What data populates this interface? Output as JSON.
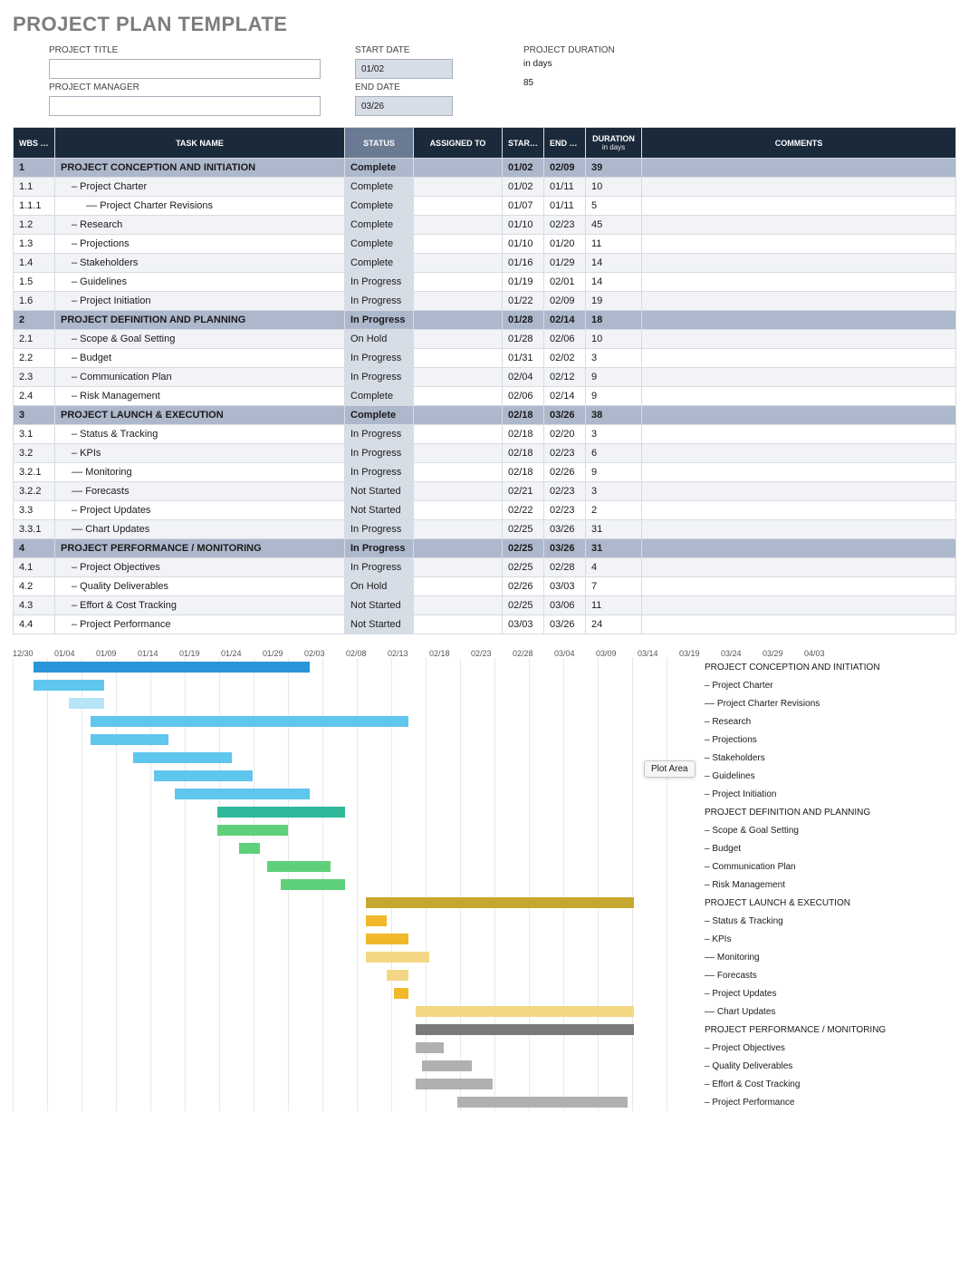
{
  "title": "PROJECT PLAN TEMPLATE",
  "meta": {
    "project_title_label": "PROJECT TITLE",
    "project_manager_label": "PROJECT MANAGER",
    "start_date_label": "START DATE",
    "start_date": "01/02",
    "end_date_label": "END DATE",
    "end_date": "03/26",
    "duration_label": "PROJECT DURATION",
    "duration_unit": "in days",
    "duration_value": "85"
  },
  "columns": {
    "wbs": "WBS NO.",
    "task": "TASK NAME",
    "status": "STATUS",
    "assigned": "ASSIGNED TO",
    "start": "START DATE",
    "end": "END DATE",
    "duration": "DURATION",
    "duration_sub": "in days",
    "comments": "COMMENTS"
  },
  "rows": [
    {
      "wbs": "1",
      "task": "PROJECT CONCEPTION AND INITIATION",
      "indent": 0,
      "section": true,
      "status": "Complete",
      "start": "01/02",
      "end": "02/09",
      "dur": "39"
    },
    {
      "wbs": "1.1",
      "task": "– Project Charter",
      "indent": 1,
      "status": "Complete",
      "start": "01/02",
      "end": "01/11",
      "dur": "10"
    },
    {
      "wbs": "1.1.1",
      "task": "–– Project Charter Revisions",
      "indent": 2,
      "status": "Complete",
      "start": "01/07",
      "end": "01/11",
      "dur": "5"
    },
    {
      "wbs": "1.2",
      "task": "– Research",
      "indent": 1,
      "status": "Complete",
      "start": "01/10",
      "end": "02/23",
      "dur": "45"
    },
    {
      "wbs": "1.3",
      "task": "– Projections",
      "indent": 1,
      "status": "Complete",
      "start": "01/10",
      "end": "01/20",
      "dur": "11"
    },
    {
      "wbs": "1.4",
      "task": "– Stakeholders",
      "indent": 1,
      "status": "Complete",
      "start": "01/16",
      "end": "01/29",
      "dur": "14"
    },
    {
      "wbs": "1.5",
      "task": "– Guidelines",
      "indent": 1,
      "status": "In Progress",
      "start": "01/19",
      "end": "02/01",
      "dur": "14"
    },
    {
      "wbs": "1.6",
      "task": "– Project Initiation",
      "indent": 1,
      "status": "In Progress",
      "start": "01/22",
      "end": "02/09",
      "dur": "19"
    },
    {
      "wbs": "2",
      "task": "PROJECT DEFINITION AND PLANNING",
      "indent": 0,
      "section": true,
      "status": "In Progress",
      "start": "01/28",
      "end": "02/14",
      "dur": "18"
    },
    {
      "wbs": "2.1",
      "task": "– Scope & Goal Setting",
      "indent": 1,
      "status": "On Hold",
      "start": "01/28",
      "end": "02/06",
      "dur": "10"
    },
    {
      "wbs": "2.2",
      "task": "– Budget",
      "indent": 1,
      "status": "In Progress",
      "start": "01/31",
      "end": "02/02",
      "dur": "3"
    },
    {
      "wbs": "2.3",
      "task": "– Communication Plan",
      "indent": 1,
      "status": "In Progress",
      "start": "02/04",
      "end": "02/12",
      "dur": "9"
    },
    {
      "wbs": "2.4",
      "task": "– Risk Management",
      "indent": 1,
      "status": "Complete",
      "start": "02/06",
      "end": "02/14",
      "dur": "9"
    },
    {
      "wbs": "3",
      "task": "PROJECT LAUNCH & EXECUTION",
      "indent": 0,
      "section": true,
      "status": "Complete",
      "start": "02/18",
      "end": "03/26",
      "dur": "38"
    },
    {
      "wbs": "3.1",
      "task": "– Status & Tracking",
      "indent": 1,
      "status": "In Progress",
      "start": "02/18",
      "end": "02/20",
      "dur": "3"
    },
    {
      "wbs": "3.2",
      "task": "– KPIs",
      "indent": 1,
      "status": "In Progress",
      "start": "02/18",
      "end": "02/23",
      "dur": "6"
    },
    {
      "wbs": "3.2.1",
      "task": "–– Monitoring",
      "indent": 1,
      "status": "In Progress",
      "start": "02/18",
      "end": "02/26",
      "dur": "9"
    },
    {
      "wbs": "3.2.2",
      "task": "–– Forecasts",
      "indent": 1,
      "status": "Not Started",
      "start": "02/21",
      "end": "02/23",
      "dur": "3"
    },
    {
      "wbs": "3.3",
      "task": "– Project Updates",
      "indent": 1,
      "status": "Not Started",
      "start": "02/22",
      "end": "02/23",
      "dur": "2"
    },
    {
      "wbs": "3.3.1",
      "task": "–– Chart Updates",
      "indent": 1,
      "status": "In Progress",
      "start": "02/25",
      "end": "03/26",
      "dur": "31"
    },
    {
      "wbs": "4",
      "task": "PROJECT PERFORMANCE / MONITORING",
      "indent": 0,
      "section": true,
      "status": "In Progress",
      "start": "02/25",
      "end": "03/26",
      "dur": "31"
    },
    {
      "wbs": "4.1",
      "task": "– Project Objectives",
      "indent": 1,
      "status": "In Progress",
      "start": "02/25",
      "end": "02/28",
      "dur": "4"
    },
    {
      "wbs": "4.2",
      "task": "– Quality Deliverables",
      "indent": 1,
      "status": "On Hold",
      "start": "02/26",
      "end": "03/03",
      "dur": "7"
    },
    {
      "wbs": "4.3",
      "task": "– Effort & Cost Tracking",
      "indent": 1,
      "status": "Not Started",
      "start": "02/25",
      "end": "03/06",
      "dur": "11"
    },
    {
      "wbs": "4.4",
      "task": "– Project Performance",
      "indent": 1,
      "status": "Not Started",
      "start": "03/03",
      "end": "03/26",
      "dur": "24"
    }
  ],
  "axis": [
    "12/30",
    "01/04",
    "01/09",
    "01/14",
    "01/19",
    "01/24",
    "01/29",
    "02/03",
    "02/08",
    "02/13",
    "02/18",
    "02/23",
    "02/28",
    "03/04",
    "03/09",
    "03/14",
    "03/19",
    "03/24",
    "03/29",
    "04/03"
  ],
  "plot_area_label": "Plot Area",
  "chart_data": {
    "type": "bar",
    "orientation": "horizontal",
    "title": "",
    "xlabel": "",
    "ylabel": "",
    "x_origin": "12/30",
    "x_unit": "days",
    "x_tick_spacing_days": 5,
    "pixels_per_day": 7.8,
    "series": [
      {
        "name": "PROJECT CONCEPTION AND INITIATION",
        "start_offset": 3,
        "duration": 39,
        "color": "#2996d9",
        "group": 1
      },
      {
        "name": "– Project Charter",
        "start_offset": 3,
        "duration": 10,
        "color": "#5fc6ee",
        "group": 1
      },
      {
        "name": "–– Project Charter Revisions",
        "start_offset": 8,
        "duration": 5,
        "color": "#b7e4f7",
        "group": 1
      },
      {
        "name": "– Research",
        "start_offset": 11,
        "duration": 45,
        "color": "#5fc6ee",
        "group": 1
      },
      {
        "name": "– Projections",
        "start_offset": 11,
        "duration": 11,
        "color": "#5fc6ee",
        "group": 1
      },
      {
        "name": "– Stakeholders",
        "start_offset": 17,
        "duration": 14,
        "color": "#5fc6ee",
        "group": 1
      },
      {
        "name": "– Guidelines",
        "start_offset": 20,
        "duration": 14,
        "color": "#5fc6ee",
        "group": 1
      },
      {
        "name": "– Project Initiation",
        "start_offset": 23,
        "duration": 19,
        "color": "#5fc6ee",
        "group": 1
      },
      {
        "name": "PROJECT DEFINITION AND PLANNING",
        "start_offset": 29,
        "duration": 18,
        "color": "#2fb89a",
        "group": 2
      },
      {
        "name": "– Scope & Goal Setting",
        "start_offset": 29,
        "duration": 10,
        "color": "#5fd07a",
        "group": 2
      },
      {
        "name": "– Budget",
        "start_offset": 32,
        "duration": 3,
        "color": "#5fd07a",
        "group": 2
      },
      {
        "name": "– Communication Plan",
        "start_offset": 36,
        "duration": 9,
        "color": "#5fd07a",
        "group": 2
      },
      {
        "name": "– Risk Management",
        "start_offset": 38,
        "duration": 9,
        "color": "#5fd07a",
        "group": 2
      },
      {
        "name": "PROJECT LAUNCH & EXECUTION",
        "start_offset": 50,
        "duration": 38,
        "color": "#c7a82f",
        "group": 3
      },
      {
        "name": "– Status & Tracking",
        "start_offset": 50,
        "duration": 3,
        "color": "#f0b92b",
        "group": 3
      },
      {
        "name": "– KPIs",
        "start_offset": 50,
        "duration": 6,
        "color": "#f0b92b",
        "group": 3
      },
      {
        "name": "–– Monitoring",
        "start_offset": 50,
        "duration": 9,
        "color": "#f4d784",
        "group": 3
      },
      {
        "name": "–– Forecasts",
        "start_offset": 53,
        "duration": 3,
        "color": "#f4d784",
        "group": 3
      },
      {
        "name": "– Project Updates",
        "start_offset": 54,
        "duration": 2,
        "color": "#f0b92b",
        "group": 3
      },
      {
        "name": "–– Chart Updates",
        "start_offset": 57,
        "duration": 31,
        "color": "#f4d784",
        "group": 3
      },
      {
        "name": "PROJECT PERFORMANCE / MONITORING",
        "start_offset": 57,
        "duration": 31,
        "color": "#7a7a7a",
        "group": 4
      },
      {
        "name": "– Project Objectives",
        "start_offset": 57,
        "duration": 4,
        "color": "#b0b0b0",
        "group": 4
      },
      {
        "name": "– Quality Deliverables",
        "start_offset": 58,
        "duration": 7,
        "color": "#b0b0b0",
        "group": 4
      },
      {
        "name": "– Effort & Cost Tracking",
        "start_offset": 57,
        "duration": 11,
        "color": "#b0b0b0",
        "group": 4
      },
      {
        "name": "– Project Performance",
        "start_offset": 63,
        "duration": 24,
        "color": "#b0b0b0",
        "group": 4
      }
    ]
  }
}
